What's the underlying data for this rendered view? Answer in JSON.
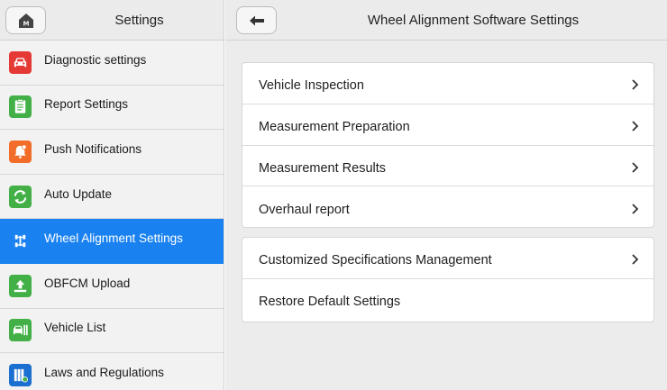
{
  "sidebar": {
    "title": "Settings",
    "home_icon": "home-icon",
    "items": [
      {
        "label": "Diagnostic settings",
        "icon": "car-icon",
        "color": "#e53935",
        "active": false
      },
      {
        "label": "Report Settings",
        "icon": "report-icon",
        "color": "#43b047",
        "active": false
      },
      {
        "label": "Push Notifications",
        "icon": "bell-icon",
        "color": "#f36d2a",
        "active": false
      },
      {
        "label": "Auto Update",
        "icon": "refresh-icon",
        "color": "#43b047",
        "active": false
      },
      {
        "label": "Wheel Alignment Settings",
        "icon": "wheel-alignment-icon",
        "color": "#1a82f0",
        "active": true
      },
      {
        "label": "OBFCM Upload",
        "icon": "upload-icon",
        "color": "#43b047",
        "active": false
      },
      {
        "label": "Vehicle List",
        "icon": "vehicle-list-icon",
        "color": "#43b047",
        "active": false
      },
      {
        "label": "Laws and Regulations",
        "icon": "books-icon",
        "color": "#1a6fd0",
        "active": false
      }
    ]
  },
  "main": {
    "title": "Wheel Alignment Software Settings",
    "back_icon": "back-arrow-icon",
    "group1": [
      {
        "label": "Vehicle Inspection"
      },
      {
        "label": "Measurement Preparation"
      },
      {
        "label": "Measurement Results"
      },
      {
        "label": "Overhaul report"
      }
    ],
    "group2": [
      {
        "label": "Customized Specifications Management",
        "chevron": true
      },
      {
        "label": "Restore Default Settings",
        "chevron": false
      }
    ]
  },
  "colors": {
    "accent": "#1a82f0",
    "background": "#ececec"
  }
}
